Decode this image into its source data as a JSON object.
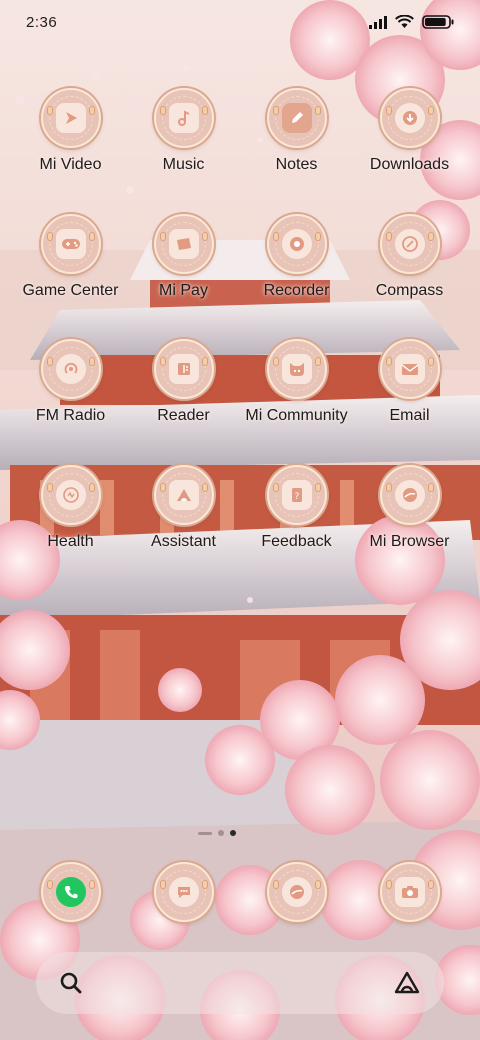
{
  "status_bar": {
    "time": "2:36",
    "icons": [
      "signal-icon",
      "wifi-icon",
      "battery-icon"
    ],
    "battery_level": 0.9
  },
  "apps": [
    {
      "label": "Mi Video",
      "icon": "play-icon"
    },
    {
      "label": "Music",
      "icon": "music-note-icon"
    },
    {
      "label": "Notes",
      "icon": "pencil-icon"
    },
    {
      "label": "Downloads",
      "icon": "download-icon"
    },
    {
      "label": "Game Center",
      "icon": "gamepad-icon"
    },
    {
      "label": "Mi Pay",
      "icon": "card-icon"
    },
    {
      "label": "Recorder",
      "icon": "record-icon"
    },
    {
      "label": "Compass",
      "icon": "compass-icon"
    },
    {
      "label": "FM Radio",
      "icon": "radio-icon"
    },
    {
      "label": "Reader",
      "icon": "book-icon"
    },
    {
      "label": "Mi Community",
      "icon": "community-icon"
    },
    {
      "label": "Email",
      "icon": "envelope-icon"
    },
    {
      "label": "Health",
      "icon": "health-icon"
    },
    {
      "label": "Assistant",
      "icon": "assistant-icon"
    },
    {
      "label": "Feedback",
      "icon": "feedback-icon"
    },
    {
      "label": "Mi Browser",
      "icon": "browser-icon"
    }
  ],
  "page_indicator": {
    "pages": 2,
    "active_page": 2
  },
  "dock": [
    {
      "name": "phone",
      "icon": "phone-icon"
    },
    {
      "name": "messages",
      "icon": "message-icon"
    },
    {
      "name": "browser",
      "icon": "browser-icon"
    },
    {
      "name": "camera",
      "icon": "camera-icon"
    }
  ],
  "search_bar": {
    "left_icon": "search-icon",
    "right_icon": "assistant-icon"
  },
  "colors": {
    "icon_fill": "#e8c4b8",
    "icon_ring": "#d9a892",
    "phone_green": "#22c55e",
    "text": "#1c1c1c"
  }
}
